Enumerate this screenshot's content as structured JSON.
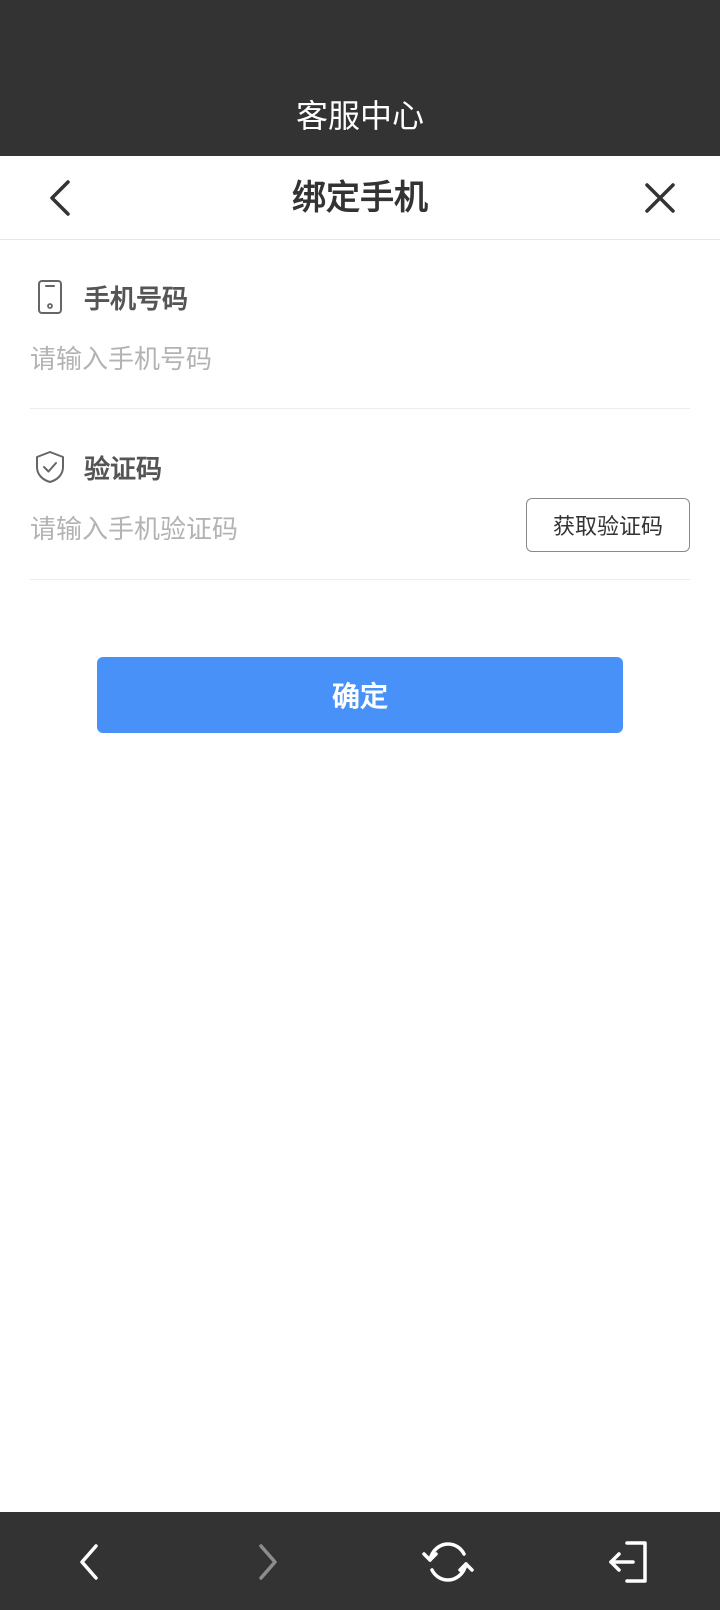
{
  "header": {
    "title": "客服中心"
  },
  "nav": {
    "title": "绑定手机",
    "back_icon": "chevron-left-icon",
    "close_icon": "close-icon"
  },
  "form": {
    "phone": {
      "label": "手机号码",
      "icon": "phone-icon",
      "placeholder": "请输入手机号码",
      "value": ""
    },
    "code": {
      "label": "验证码",
      "icon": "shield-check-icon",
      "placeholder": "请输入手机验证码",
      "value": "",
      "get_code_label": "获取验证码"
    },
    "confirm_label": "确定"
  },
  "colors": {
    "bar_background": "#333333",
    "primary": "#4891f8",
    "placeholder": "#b3b3b3"
  },
  "bottom_bar": {
    "icons": [
      "back-arrow-icon",
      "forward-arrow-icon",
      "refresh-icon",
      "exit-icon"
    ]
  }
}
